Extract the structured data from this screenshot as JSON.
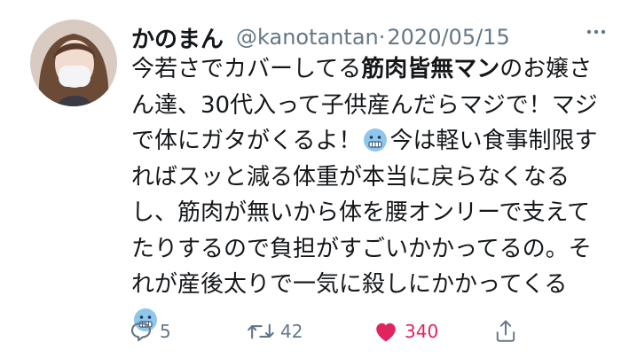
{
  "tweet": {
    "display_name": "かのまん",
    "handle": "@kanotantan",
    "separator": "·",
    "date": "2020/05/15",
    "more_icon": "ellipsis-icon",
    "text_segments": {
      "s1": "今若さでカバーしてる",
      "s2_bold": "筋肉皆無マン",
      "s3": "のお嬢さん達、30代入って子供産んだらマジで！マジで体にガタがくるよ！",
      "s4": "今は軽い食事制限すればスッと減る体重が本当に戻らなくなるし、筋肉が無いから体を腰オンリーで支えてたりするので負担がすごいかかってるの。それが産後太りで一気に殺しにかかってくる"
    },
    "emoji": "cold-face-emoji"
  },
  "actions": {
    "reply": {
      "icon": "reply-icon",
      "count": "5"
    },
    "retweet": {
      "icon": "retweet-icon",
      "count": "42"
    },
    "like": {
      "icon": "heart-icon",
      "count": "340",
      "color": "#e0245e"
    },
    "share": {
      "icon": "share-icon"
    }
  },
  "colors": {
    "text": "#14171a",
    "secondary": "#657786",
    "like": "#e0245e",
    "emoji": "#8fc6ec"
  }
}
